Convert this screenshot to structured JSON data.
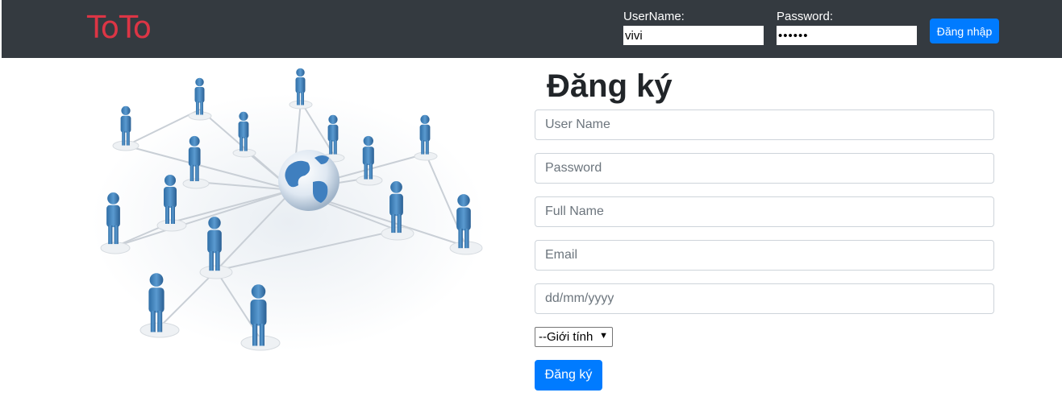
{
  "navbar": {
    "brand": "ToTo",
    "username_label": "UserName:",
    "username_value": "vivi",
    "password_label": "Password:",
    "password_value": "••••••",
    "login_button": "Đăng nhập"
  },
  "register": {
    "title": "Đăng ký",
    "username_placeholder": "User Name",
    "password_placeholder": "Password",
    "fullname_placeholder": "Full Name",
    "email_placeholder": "Email",
    "date_placeholder": "dd/mm/yyyy",
    "gender_selected": "--Giới tính",
    "submit_button": "Đăng ký"
  },
  "colors": {
    "navbar_bg": "#343a40",
    "brand": "#dc3545",
    "primary": "#007bff"
  }
}
